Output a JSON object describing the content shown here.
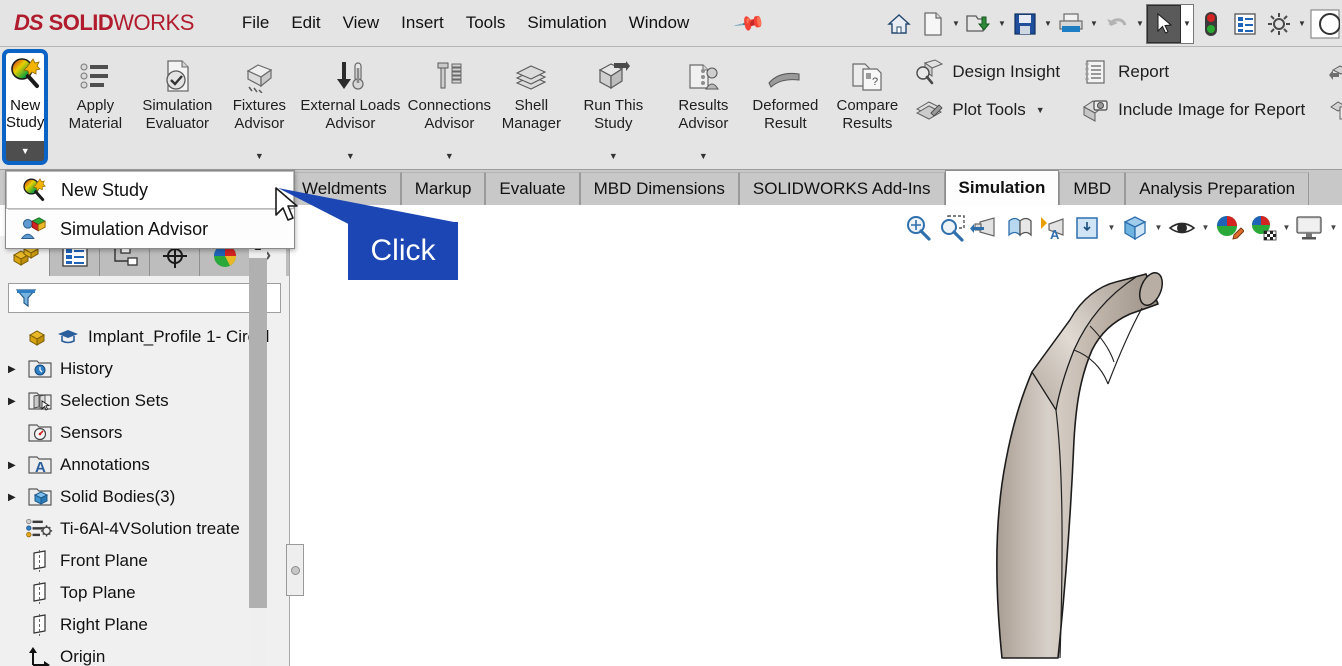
{
  "app": {
    "brand_ds": "DS",
    "brand_name_bold": "SOLID",
    "brand_name_light": "WORKS",
    "brand_color": "#b01c2e"
  },
  "menubar": {
    "items": [
      {
        "label": "File"
      },
      {
        "label": "Edit"
      },
      {
        "label": "View"
      },
      {
        "label": "Insert"
      },
      {
        "label": "Tools"
      },
      {
        "label": "Simulation"
      },
      {
        "label": "Window"
      }
    ],
    "pin_icon": "pin-icon"
  },
  "quick_access": {
    "icons": [
      {
        "name": "home-icon",
        "caret": false
      },
      {
        "name": "new-document-icon",
        "caret": true
      },
      {
        "name": "open-folder-icon",
        "caret": true
      },
      {
        "name": "save-icon",
        "caret": true
      },
      {
        "name": "print-icon",
        "caret": true
      },
      {
        "name": "undo-icon",
        "caret": true
      },
      {
        "name": "select-arrow-icon",
        "caret": true,
        "selected": true
      },
      {
        "name": "rebuild-indicator-icon",
        "caret": false
      },
      {
        "name": "display-list-icon",
        "caret": false
      },
      {
        "name": "options-gear-icon",
        "caret": true
      }
    ]
  },
  "ribbon": {
    "new_study": {
      "label_line1": "New",
      "label_line2": "Study",
      "icon": "new-study-icon",
      "highlight_color": "#0b63c5",
      "has_dropdown": true
    },
    "buttons": [
      {
        "label": "Apply Material",
        "icon": "apply-material-icon",
        "caret": false
      },
      {
        "label": "Simulation Evaluator",
        "icon": "simulation-evaluator-icon",
        "caret": false
      },
      {
        "label": "Fixtures Advisor",
        "icon": "fixtures-advisor-icon",
        "caret": true
      },
      {
        "label": "External Loads Advisor",
        "icon": "external-loads-advisor-icon",
        "caret": true
      },
      {
        "label": "Connections Advisor",
        "icon": "connections-advisor-icon",
        "caret": true
      },
      {
        "label": "Shell Manager",
        "icon": "shell-manager-icon",
        "caret": false
      },
      {
        "label": "Run This Study",
        "icon": "run-this-study-icon",
        "caret": true
      }
    ],
    "results_buttons": [
      {
        "label": "Results Advisor",
        "icon": "results-advisor-icon",
        "caret": true
      },
      {
        "label": "Deformed Result",
        "icon": "deformed-result-icon",
        "caret": false
      },
      {
        "label": "Compare Results",
        "icon": "compare-results-icon",
        "caret": false
      }
    ],
    "text_buttons": [
      {
        "label": "Design Insight",
        "icon": "design-insight-icon",
        "caret": false
      },
      {
        "label": "Plot Tools",
        "icon": "plot-tools-icon",
        "caret": true
      }
    ],
    "report_buttons": [
      {
        "label": "Report",
        "icon": "report-icon"
      },
      {
        "label": "Include Image for Report",
        "icon": "include-image-icon"
      }
    ]
  },
  "dropdown": {
    "items": [
      {
        "label": "New Study",
        "icon": "new-study-icon",
        "hovered": true
      },
      {
        "label": "Simulation Advisor",
        "icon": "simulation-advisor-icon",
        "hovered": false
      }
    ]
  },
  "tabs": {
    "items": [
      {
        "label": "Weldments",
        "active": false,
        "clipped": true
      },
      {
        "label": "Markup",
        "active": false
      },
      {
        "label": "Evaluate",
        "active": false
      },
      {
        "label": "MBD Dimensions",
        "active": false
      },
      {
        "label": "SOLIDWORKS Add-Ins",
        "active": false
      },
      {
        "label": "Simulation",
        "active": true
      },
      {
        "label": "MBD",
        "active": false
      },
      {
        "label": "Analysis Preparation",
        "active": false
      }
    ]
  },
  "view_toolbar": {
    "icons": [
      {
        "name": "zoom-to-fit-icon",
        "caret": false
      },
      {
        "name": "zoom-to-area-icon",
        "caret": false
      },
      {
        "name": "previous-view-icon",
        "caret": false
      },
      {
        "name": "section-view-icon",
        "caret": false
      },
      {
        "name": "view-orientation-icon",
        "caret": false
      },
      {
        "name": "display-style-box-icon",
        "caret": true
      },
      {
        "name": "display-style-icon",
        "caret": true
      },
      {
        "name": "hide-show-items-icon",
        "caret": true
      },
      {
        "name": "edit-appearance-icon",
        "caret": false
      },
      {
        "name": "apply-scene-icon",
        "caret": true
      },
      {
        "name": "view-settings-icon",
        "caret": true
      }
    ]
  },
  "left_panel": {
    "panel_tabs": [
      {
        "name": "feature-manager-tab",
        "icon": "feature-tree-icon",
        "active": true
      },
      {
        "name": "property-manager-tab",
        "icon": "property-manager-icon",
        "active": false
      },
      {
        "name": "configuration-manager-tab",
        "icon": "configuration-manager-icon",
        "active": false
      },
      {
        "name": "dimxpert-manager-tab",
        "icon": "dimxpert-icon",
        "active": false
      },
      {
        "name": "display-manager-tab",
        "icon": "display-manager-icon",
        "active": false
      },
      {
        "name": "expand-panel-tab",
        "icon": "chevron-right-icon",
        "active": false
      }
    ],
    "filter_icon": "filter-funnel-icon",
    "tree": [
      {
        "label": "Implant_Profile 1- Circul",
        "icon": "part-document-icon",
        "arrow": false,
        "root": true,
        "badge": "study-cap-icon"
      },
      {
        "label": "History",
        "icon": "history-folder-icon",
        "arrow": true
      },
      {
        "label": "Selection Sets",
        "icon": "selection-sets-icon",
        "arrow": true
      },
      {
        "label": "Sensors",
        "icon": "sensors-icon",
        "arrow": false
      },
      {
        "label": "Annotations",
        "icon": "annotations-icon",
        "arrow": true
      },
      {
        "label": "Solid Bodies(3)",
        "icon": "solid-bodies-icon",
        "arrow": true
      },
      {
        "label": "Ti-6Al-4VSolution treate",
        "icon": "material-icon",
        "arrow": false
      },
      {
        "label": "Front Plane",
        "icon": "plane-icon",
        "arrow": false
      },
      {
        "label": "Top Plane",
        "icon": "plane-icon",
        "arrow": false
      },
      {
        "label": "Right Plane",
        "icon": "plane-icon",
        "arrow": false
      },
      {
        "label": "Origin",
        "icon": "origin-icon",
        "arrow": false
      }
    ],
    "scroll_up_icon": "chevron-up-icon"
  },
  "callout": {
    "label": "Click",
    "color": "#1b46b4"
  },
  "model": {
    "name": "hip-implant-stem-3d-model",
    "surface_color": "#c3b7ac"
  }
}
